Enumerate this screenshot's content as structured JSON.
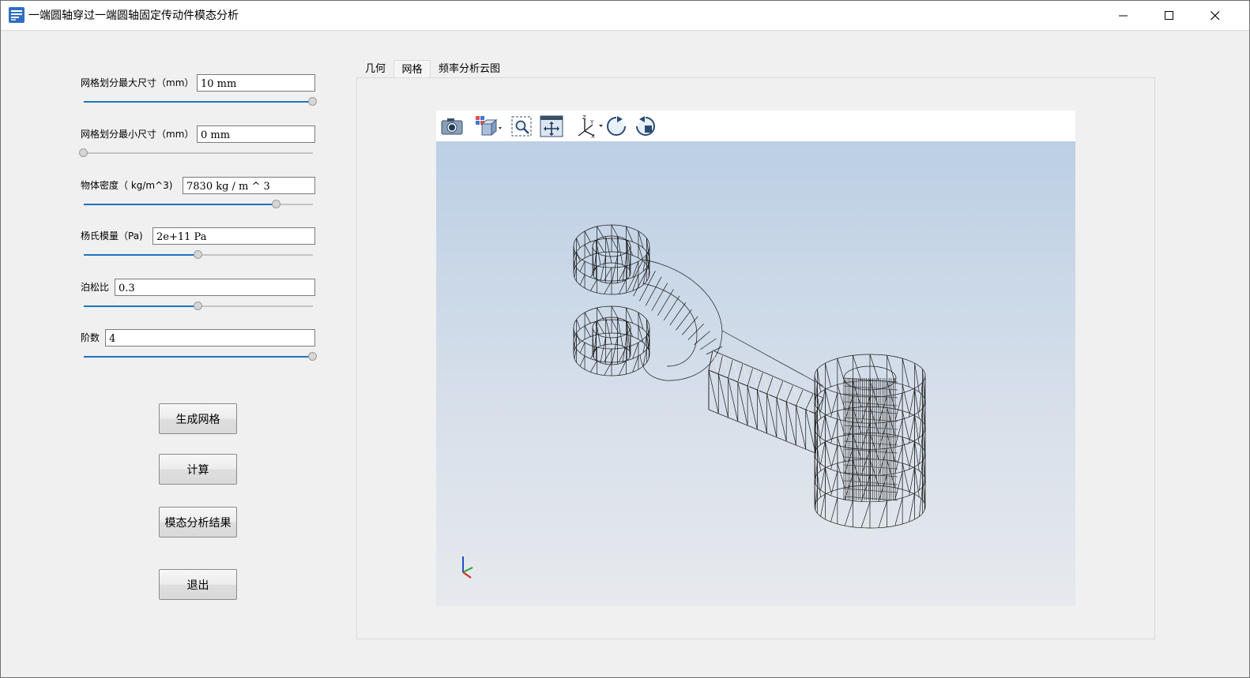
{
  "window": {
    "title": "一端圆轴穿过一端圆轴固定传动件模态分析",
    "controls": [
      "minimize",
      "maximize",
      "close"
    ]
  },
  "params": [
    {
      "label": "网格划分最大尺寸（mm）",
      "value": "10 mm",
      "slider": 1.0
    },
    {
      "label": "网格划分最小尺寸（mm）",
      "value": "0 mm",
      "slider": 0.0
    },
    {
      "label": "物体密度（ kg/m^3)",
      "value": "7830 kg / m ^ 3",
      "slider": 0.84
    },
    {
      "label": "杨氏模量（Pa)",
      "value": "2e+11 Pa",
      "slider": 0.5
    },
    {
      "label": "泊松比",
      "value": "0.3",
      "slider": 0.5
    },
    {
      "label": "阶数",
      "value": "4",
      "slider": 1.0
    }
  ],
  "buttons": {
    "generate_mesh": "生成网格",
    "compute": "计算",
    "modal_results": "模态分析结果",
    "exit": "退出"
  },
  "tabs": [
    {
      "label": "几何",
      "active": false
    },
    {
      "label": "网格",
      "active": true
    },
    {
      "label": "频率分析云图",
      "active": false
    }
  ],
  "viewer": {
    "toolbar_icons": [
      "camera-icon",
      "view-cube-icon",
      "zoom-box-icon",
      "fit-all-icon",
      "axes-orientation-icon",
      "rotate-cw-icon",
      "rotate-ccw-icon"
    ],
    "axis_labels": {
      "x": "X",
      "y": "Y",
      "z": "Z"
    },
    "colors": {
      "bg_top": "#bccfe4",
      "bg_bottom": "#e7e9ed",
      "mesh": "#1a1a1a",
      "accent": "#1e73be"
    }
  }
}
